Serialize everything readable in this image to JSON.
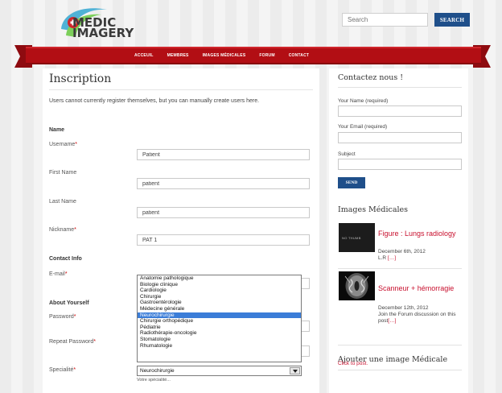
{
  "site": {
    "logo_line1": "MEDIC",
    "logo_line2": "IMAGERY",
    "search_placeholder": "Search",
    "search_button": "SEARCH",
    "colors": {
      "brand_red": "#b20e14",
      "brand_blue": "#1f4f8a",
      "link_red": "#c8102e"
    }
  },
  "nav": [
    "ACCEUIL",
    "MEMBRES",
    "IMAGES MÉDICALES",
    "FORUM",
    "CONTACT"
  ],
  "form": {
    "title": "Inscription",
    "notice": "Users cannot currently register themselves, but you can manually create users here.",
    "section_name": "Name",
    "username_label": "Username",
    "username_value": "Patient",
    "first_name_label": "First Name",
    "first_name_value": "patient",
    "last_name_label": "Last Name",
    "last_name_value": "patient",
    "nickname_label": "Nickname",
    "nickname_value": "PAT 1",
    "section_contact": "Contact Info",
    "email_label": "E-mail",
    "section_about": "About Yourself",
    "password_label": "Password",
    "repeat_password_label": "Repeat Password",
    "speciality_label": "Specialité",
    "speciality_selected": "Neurochirurgie",
    "speciality_hint": "Votre spécialité...",
    "speciality_options": [
      "Anatomie pathologique",
      "Biologie clinique",
      "Cardiologie",
      "Chirurgie",
      "Gastroentérologie",
      "Médecine générale",
      "Neurochirurgie",
      "Chirurgie orthopédique",
      "Pédiatrie",
      "Radiothérapie-oncologie",
      "Stomatologie",
      "Rhumatologie"
    ],
    "required_mark": "*"
  },
  "sidebar": {
    "contact_title": "Contactez nous !",
    "your_name_label": "Your Name (required)",
    "your_email_label": "Your Email (required)",
    "subject_label": "Subject",
    "send_button": "SEND",
    "images_title": "Images Médicales",
    "posts": [
      {
        "thumb_text": "NO THUMB",
        "title": "Figure : Lungs radiology",
        "date": "December 6th, 2012",
        "excerpt": "L.R ",
        "more": "[…]"
      },
      {
        "title": "Scanneur + hémorragie",
        "date": "December 12th, 2012",
        "excerpt": "Join the Forum discussion on this post",
        "more": "[…]"
      }
    ],
    "add_image_title": "Ajouter une image Médicale",
    "click_to_post": "Click to post."
  }
}
